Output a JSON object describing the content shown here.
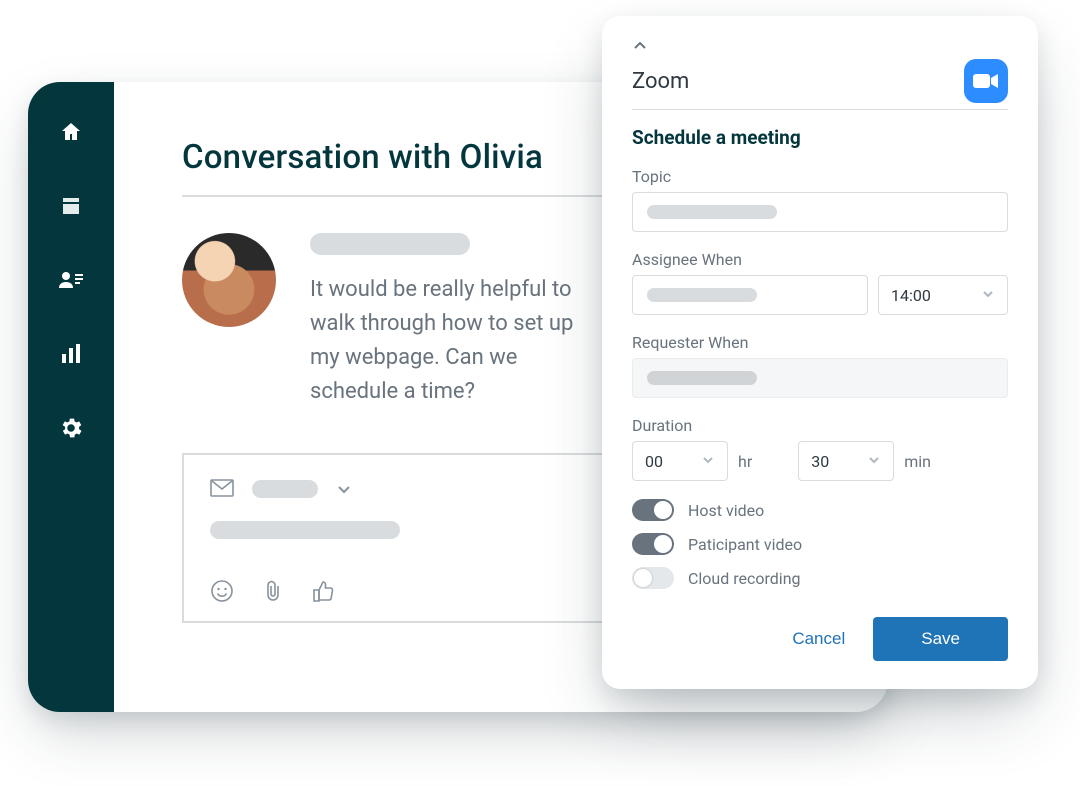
{
  "page_title": "Conversation with Olivia",
  "message_text": "It would be really helpful to walk through how to set up my webpage. Can we schedule a time?",
  "panel": {
    "title": "Zoom",
    "subtitle": "Schedule a meeting",
    "labels": {
      "topic": "Topic",
      "assignee_when": "Assignee When",
      "requester_when": "Requester When",
      "duration": "Duration",
      "hr": "hr",
      "min": "min"
    },
    "assignee_time": "14:00",
    "duration_hr": "00",
    "duration_min": "30",
    "toggles": {
      "host_video": "Host video",
      "participant_video": "Paticipant video",
      "cloud_recording": "Cloud recording"
    },
    "buttons": {
      "cancel": "Cancel",
      "save": "Save"
    }
  }
}
